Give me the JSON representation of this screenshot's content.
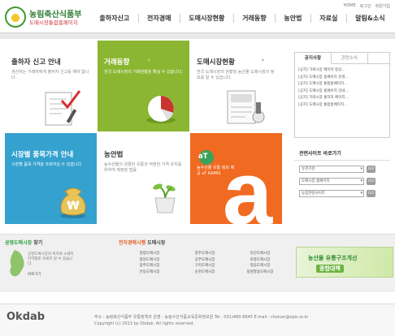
{
  "header": {
    "title": "농림축산식품부",
    "subtitle": "도매시장통합홈페이지",
    "util_links": [
      "HOME",
      "로그인",
      "회원가입"
    ],
    "nav": [
      "출하자신고",
      "전자경매",
      "도매시장현황",
      "거래동향",
      "농안법",
      "자료실",
      "알림&소식"
    ]
  },
  "tiles": {
    "shipper": {
      "title": "출하자 신고 안내",
      "desc": "생산자는 거래자에게 출하자 신고를 해야 합니다."
    },
    "auction": {
      "title": "거래동향",
      "desc": "전국 도매시장의 거래현황을 확실 수 있습니다."
    },
    "wholesale": {
      "title": "도매시장현황",
      "desc": "전국 도매시장의 현황및 농산물 도매시장의 정보를 알 수 있습니다."
    },
    "price": {
      "title": "시장별 품목가격 안내",
      "desc": "시장별 품목 가격을 조회하실 수 있습니다."
    },
    "agri": {
      "title": "농안법",
      "desc": "농수산물의 원활한 유통과 적정한 가격 유지를 위하여 제정된 법률"
    },
    "atcenter": {
      "title": "aT",
      "desc": "농수산물 유통 정보 제공 aT KAMIS"
    }
  },
  "notice": {
    "tabs": [
      "공지사항",
      "관련소식"
    ],
    "items": [
      "[공지] 가락시장 페이지 정상...",
      "[공지] 도매시장 홈페이지 운영...",
      "[공지] 도매시장 통합홈페이지...",
      "[공지] 도매시장 홈페이지 안내...",
      "[공지] 가락시장 출하자 페이지...",
      "[공지] 도매시장 통합홈페이지..."
    ]
  },
  "related": {
    "title": "관련사이트 바로가기",
    "selects": [
      "유관기관",
      "도매시장 홈페이지",
      "농업관련사이트"
    ],
    "go_label": "GO"
  },
  "market_section": {
    "title_accent": "공영도매시장",
    "title_rest": "찾기",
    "desc": "공영도매시장의 위치와 소재지 지역별로 자세히 알 수 있습니다.",
    "more": "바로가기"
  },
  "elec_section": {
    "title_accent": "전자경매시행",
    "title_rest": "도매시장",
    "markets": [
      "청량도매시장",
      "청주도매시장",
      "익산도매시장",
      "창원도매시장",
      "공주도매시장",
      "포항도매시장",
      "광주도매시장",
      "구미도매시장",
      "정읍도매시장",
      "안동도매시장",
      "순천도매시장",
      "창원팔용도매시장"
    ]
  },
  "banner": {
    "line1": "농산물 유통구조개선",
    "line2": "종합대책"
  },
  "footer": {
    "logo": "Okdab",
    "address": "주소 : 농림축산식품부 유통정책과    운영 : 농림수산식품교육문화정보원    Tel : 031)460-8845    E-mail : choicer@epis.or.kr",
    "copyright": "Copyright (c) 2013 by Okdab. All rights reserved."
  },
  "colors": {
    "auction_tile": "#8ab631",
    "price_tile": "#35a1cf",
    "atcenter_tile": "#f06a21",
    "brand_green": "#2f7d32"
  },
  "icons": [
    "checklist-icon",
    "pie-chart-icon",
    "document-stamp-icon",
    "money-bag-icon",
    "sprout-pot-icon",
    "at-logo-icon",
    "korea-map-icon"
  ]
}
